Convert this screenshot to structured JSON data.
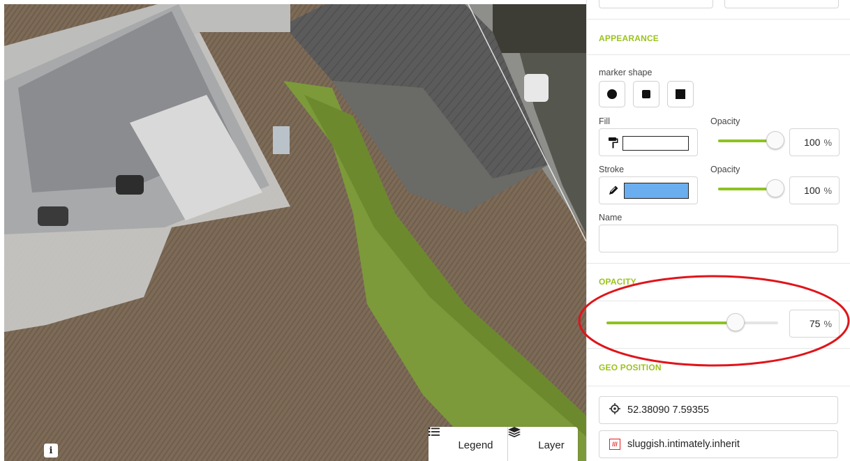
{
  "appearance": {
    "title": "APPEARANCE",
    "marker_shape_label": "marker shape",
    "marker_shapes": [
      "circle-icon",
      "small-square-icon",
      "square-icon"
    ],
    "fill_label": "Fill",
    "fill_opacity_label": "Opacity",
    "fill_color": "#ffffff",
    "fill_opacity_value": "100",
    "stroke_label": "Stroke",
    "stroke_opacity_label": "Opacity",
    "stroke_color": "#6aaef0",
    "stroke_opacity_value": "100",
    "name_label": "Name",
    "name_value": "",
    "unit": "%",
    "fill_opacity_fraction": 1.0,
    "stroke_opacity_fraction": 1.0
  },
  "opacity": {
    "title": "OPACITY",
    "value": "75",
    "unit": "%",
    "fraction": 0.75
  },
  "geo_position": {
    "title": "GEO POSITION",
    "coordinates": "52.38090 7.59355",
    "what3words": "sluggish.intimately.inherit"
  },
  "map_controls": {
    "legend_label": "Legend",
    "layer_label": "Layer",
    "info_label": "i"
  },
  "colors": {
    "accent": "#9bc31c",
    "highlight_ring": "#e0141a"
  }
}
